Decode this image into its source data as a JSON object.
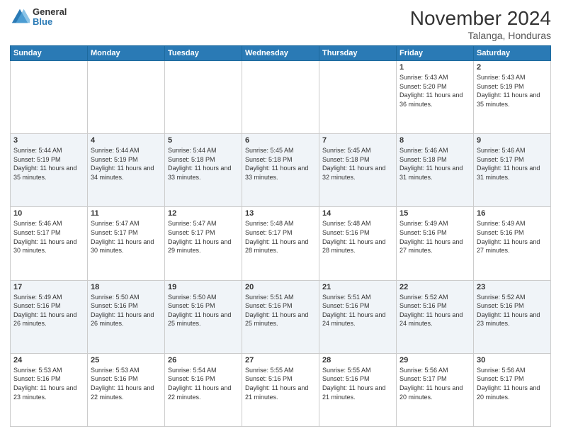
{
  "logo": {
    "general": "General",
    "blue": "Blue"
  },
  "title": "November 2024",
  "location": "Talanga, Honduras",
  "headers": [
    "Sunday",
    "Monday",
    "Tuesday",
    "Wednesday",
    "Thursday",
    "Friday",
    "Saturday"
  ],
  "weeks": [
    [
      {
        "day": "",
        "sunrise": "",
        "sunset": "",
        "daylight": ""
      },
      {
        "day": "",
        "sunrise": "",
        "sunset": "",
        "daylight": ""
      },
      {
        "day": "",
        "sunrise": "",
        "sunset": "",
        "daylight": ""
      },
      {
        "day": "",
        "sunrise": "",
        "sunset": "",
        "daylight": ""
      },
      {
        "day": "",
        "sunrise": "",
        "sunset": "",
        "daylight": ""
      },
      {
        "day": "1",
        "sunrise": "Sunrise: 5:43 AM",
        "sunset": "Sunset: 5:20 PM",
        "daylight": "Daylight: 11 hours and 36 minutes."
      },
      {
        "day": "2",
        "sunrise": "Sunrise: 5:43 AM",
        "sunset": "Sunset: 5:19 PM",
        "daylight": "Daylight: 11 hours and 35 minutes."
      }
    ],
    [
      {
        "day": "3",
        "sunrise": "Sunrise: 5:44 AM",
        "sunset": "Sunset: 5:19 PM",
        "daylight": "Daylight: 11 hours and 35 minutes."
      },
      {
        "day": "4",
        "sunrise": "Sunrise: 5:44 AM",
        "sunset": "Sunset: 5:19 PM",
        "daylight": "Daylight: 11 hours and 34 minutes."
      },
      {
        "day": "5",
        "sunrise": "Sunrise: 5:44 AM",
        "sunset": "Sunset: 5:18 PM",
        "daylight": "Daylight: 11 hours and 33 minutes."
      },
      {
        "day": "6",
        "sunrise": "Sunrise: 5:45 AM",
        "sunset": "Sunset: 5:18 PM",
        "daylight": "Daylight: 11 hours and 33 minutes."
      },
      {
        "day": "7",
        "sunrise": "Sunrise: 5:45 AM",
        "sunset": "Sunset: 5:18 PM",
        "daylight": "Daylight: 11 hours and 32 minutes."
      },
      {
        "day": "8",
        "sunrise": "Sunrise: 5:46 AM",
        "sunset": "Sunset: 5:18 PM",
        "daylight": "Daylight: 11 hours and 31 minutes."
      },
      {
        "day": "9",
        "sunrise": "Sunrise: 5:46 AM",
        "sunset": "Sunset: 5:17 PM",
        "daylight": "Daylight: 11 hours and 31 minutes."
      }
    ],
    [
      {
        "day": "10",
        "sunrise": "Sunrise: 5:46 AM",
        "sunset": "Sunset: 5:17 PM",
        "daylight": "Daylight: 11 hours and 30 minutes."
      },
      {
        "day": "11",
        "sunrise": "Sunrise: 5:47 AM",
        "sunset": "Sunset: 5:17 PM",
        "daylight": "Daylight: 11 hours and 30 minutes."
      },
      {
        "day": "12",
        "sunrise": "Sunrise: 5:47 AM",
        "sunset": "Sunset: 5:17 PM",
        "daylight": "Daylight: 11 hours and 29 minutes."
      },
      {
        "day": "13",
        "sunrise": "Sunrise: 5:48 AM",
        "sunset": "Sunset: 5:17 PM",
        "daylight": "Daylight: 11 hours and 28 minutes."
      },
      {
        "day": "14",
        "sunrise": "Sunrise: 5:48 AM",
        "sunset": "Sunset: 5:16 PM",
        "daylight": "Daylight: 11 hours and 28 minutes."
      },
      {
        "day": "15",
        "sunrise": "Sunrise: 5:49 AM",
        "sunset": "Sunset: 5:16 PM",
        "daylight": "Daylight: 11 hours and 27 minutes."
      },
      {
        "day": "16",
        "sunrise": "Sunrise: 5:49 AM",
        "sunset": "Sunset: 5:16 PM",
        "daylight": "Daylight: 11 hours and 27 minutes."
      }
    ],
    [
      {
        "day": "17",
        "sunrise": "Sunrise: 5:49 AM",
        "sunset": "Sunset: 5:16 PM",
        "daylight": "Daylight: 11 hours and 26 minutes."
      },
      {
        "day": "18",
        "sunrise": "Sunrise: 5:50 AM",
        "sunset": "Sunset: 5:16 PM",
        "daylight": "Daylight: 11 hours and 26 minutes."
      },
      {
        "day": "19",
        "sunrise": "Sunrise: 5:50 AM",
        "sunset": "Sunset: 5:16 PM",
        "daylight": "Daylight: 11 hours and 25 minutes."
      },
      {
        "day": "20",
        "sunrise": "Sunrise: 5:51 AM",
        "sunset": "Sunset: 5:16 PM",
        "daylight": "Daylight: 11 hours and 25 minutes."
      },
      {
        "day": "21",
        "sunrise": "Sunrise: 5:51 AM",
        "sunset": "Sunset: 5:16 PM",
        "daylight": "Daylight: 11 hours and 24 minutes."
      },
      {
        "day": "22",
        "sunrise": "Sunrise: 5:52 AM",
        "sunset": "Sunset: 5:16 PM",
        "daylight": "Daylight: 11 hours and 24 minutes."
      },
      {
        "day": "23",
        "sunrise": "Sunrise: 5:52 AM",
        "sunset": "Sunset: 5:16 PM",
        "daylight": "Daylight: 11 hours and 23 minutes."
      }
    ],
    [
      {
        "day": "24",
        "sunrise": "Sunrise: 5:53 AM",
        "sunset": "Sunset: 5:16 PM",
        "daylight": "Daylight: 11 hours and 23 minutes."
      },
      {
        "day": "25",
        "sunrise": "Sunrise: 5:53 AM",
        "sunset": "Sunset: 5:16 PM",
        "daylight": "Daylight: 11 hours and 22 minutes."
      },
      {
        "day": "26",
        "sunrise": "Sunrise: 5:54 AM",
        "sunset": "Sunset: 5:16 PM",
        "daylight": "Daylight: 11 hours and 22 minutes."
      },
      {
        "day": "27",
        "sunrise": "Sunrise: 5:55 AM",
        "sunset": "Sunset: 5:16 PM",
        "daylight": "Daylight: 11 hours and 21 minutes."
      },
      {
        "day": "28",
        "sunrise": "Sunrise: 5:55 AM",
        "sunset": "Sunset: 5:16 PM",
        "daylight": "Daylight: 11 hours and 21 minutes."
      },
      {
        "day": "29",
        "sunrise": "Sunrise: 5:56 AM",
        "sunset": "Sunset: 5:17 PM",
        "daylight": "Daylight: 11 hours and 20 minutes."
      },
      {
        "day": "30",
        "sunrise": "Sunrise: 5:56 AM",
        "sunset": "Sunset: 5:17 PM",
        "daylight": "Daylight: 11 hours and 20 minutes."
      }
    ]
  ]
}
